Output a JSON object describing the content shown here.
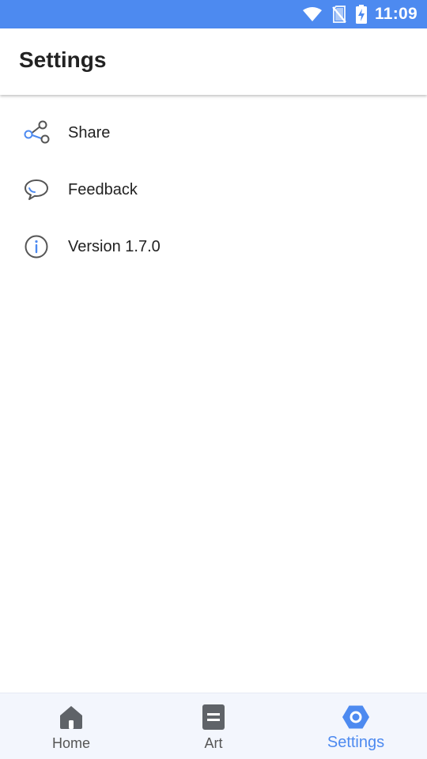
{
  "status_bar": {
    "time": "11:09",
    "icons": [
      "wifi-icon",
      "no-sim-icon",
      "battery-charging-icon"
    ],
    "background": "#4d8af0"
  },
  "app_bar": {
    "title": "Settings"
  },
  "settings": {
    "items": [
      {
        "icon": "share-icon",
        "label": "Share"
      },
      {
        "icon": "feedback-icon",
        "label": "Feedback"
      },
      {
        "icon": "info-icon",
        "label": "Version 1.7.0"
      }
    ]
  },
  "bottom_nav": {
    "items": [
      {
        "icon": "home-icon",
        "label": "Home",
        "active": false
      },
      {
        "icon": "article-icon",
        "label": "Art",
        "active": false
      },
      {
        "icon": "settings-icon",
        "label": "Settings",
        "active": true
      }
    ],
    "active_color": "#4d8af0",
    "inactive_color": "#555555"
  }
}
